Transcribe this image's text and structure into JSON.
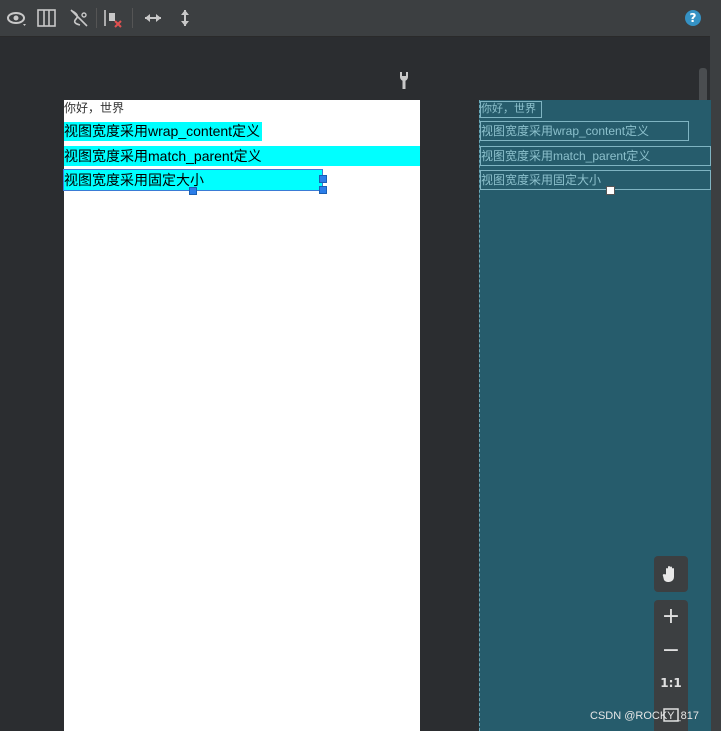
{
  "toolbar": {
    "icons": [
      "eye-icon",
      "columns-icon",
      "hide-constraints-icon",
      "clear-constraints-icon",
      "horizontal-arrow-icon",
      "vertical-arrow-icon"
    ],
    "help": "?"
  },
  "design": {
    "hello": "你好，世界",
    "wrap": "视图宽度采用wrap_content定义",
    "match": "视图宽度采用match_parent定义",
    "fixed": "视图宽度采用固定大小"
  },
  "blueprint": {
    "hello": "你好，世界",
    "wrap": "视图宽度采用wrap_content定义",
    "match": "视图宽度采用match_parent定义",
    "fixed": "视图宽度采用固定大小"
  },
  "zoom": {
    "plus": "+",
    "minus": "−",
    "one_to_one": "1:1"
  },
  "watermark": "CSDN @ROCKY_817",
  "colors": {
    "cyan": "#00ffff",
    "blueprint_bg": "#265c6c",
    "canvas_bg": "#2b2d30"
  }
}
